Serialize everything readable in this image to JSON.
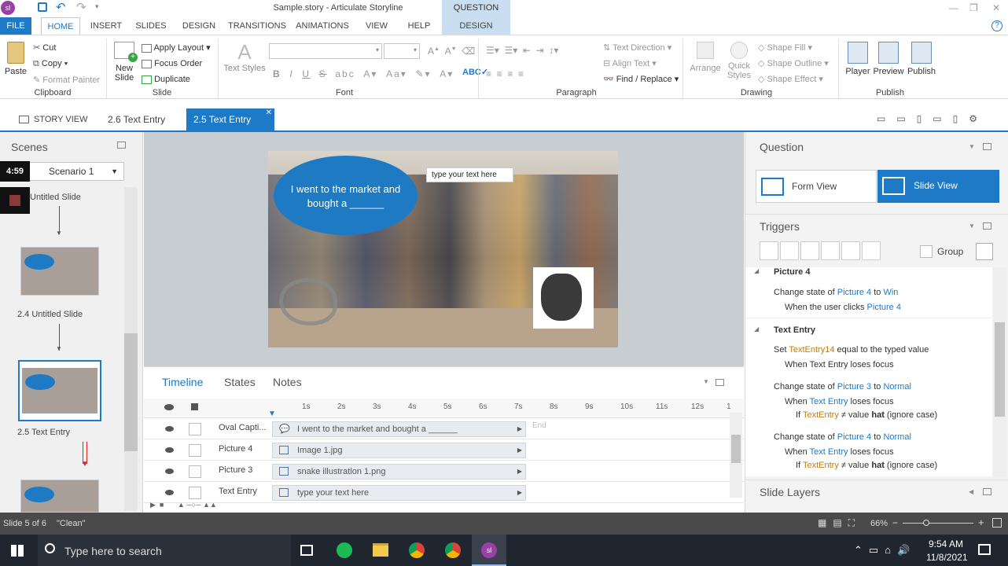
{
  "window": {
    "title": "Sample.story - Articulate Storyline",
    "context_tab": "QUESTION TOOLS"
  },
  "ribbon_tabs": [
    "FILE",
    "HOME",
    "INSERT",
    "SLIDES",
    "DESIGN",
    "TRANSITIONS",
    "ANIMATIONS",
    "VIEW",
    "HELP",
    "DESIGN"
  ],
  "clipboard": {
    "paste": "Paste",
    "cut": "Cut",
    "copy": "Copy",
    "format_painter": "Format Painter",
    "label": "Clipboard"
  },
  "slide_grp": {
    "new_slide": "New Slide",
    "apply_layout": "Apply Layout",
    "focus_order": "Focus Order",
    "duplicate": "Duplicate",
    "label": "Slide"
  },
  "font_grp": {
    "text_styles": "Text Styles",
    "label": "Font"
  },
  "paragraph_grp": {
    "text_direction": "Text Direction",
    "align_text": "Align Text",
    "find_replace": "Find / Replace",
    "label": "Paragraph"
  },
  "drawing_grp": {
    "arrange": "Arrange",
    "quick_styles": "Quick Styles",
    "shape_fill": "Shape Fill",
    "shape_outline": "Shape Outline",
    "shape_effect": "Shape Effect",
    "label": "Drawing"
  },
  "publish_grp": {
    "player": "Player",
    "preview": "Preview",
    "publish": "Publish",
    "label": "Publish"
  },
  "view_tabs": {
    "story_view": "STORY VIEW",
    "tab1": "2.6 Text Entry",
    "tab2": "2.5 Text Entry"
  },
  "scenes": {
    "title": "Scenes",
    "timer": "4:59",
    "scenario": "Scenario 1",
    "slides": [
      {
        "label": "Untitled Slide"
      },
      {
        "label": "2.4 Untitled Slide"
      },
      {
        "label": "2.5 Text Entry"
      }
    ]
  },
  "slide": {
    "bubble_text": "I went to the market and bought a ______",
    "text_entry_placeholder": "type your text here"
  },
  "timeline": {
    "tabs": [
      "Timeline",
      "States",
      "Notes"
    ],
    "ticks": [
      "1s",
      "2s",
      "3s",
      "4s",
      "5s",
      "6s",
      "7s",
      "8s",
      "9s",
      "10s",
      "11s",
      "12s",
      "1"
    ],
    "end": "End",
    "rows": [
      {
        "name": "Oval Capti...",
        "bar": "I went to the market and bought a ______"
      },
      {
        "name": "Picture 4",
        "bar": "Image 1.jpg"
      },
      {
        "name": "Picture 3",
        "bar": "snake illustration 1.png"
      },
      {
        "name": "Text Entry",
        "bar": "type your text here"
      }
    ]
  },
  "question": {
    "title": "Question",
    "form_view": "Form View",
    "slide_view": "Slide View"
  },
  "triggers": {
    "title": "Triggers",
    "group": "Group",
    "g1": "Picture 4",
    "t1a": "Change state of ",
    "t1b": "Picture 4",
    "t1c": " to ",
    "t1d": "Win",
    "t1e": "When the user clicks ",
    "t1f": "Picture 4",
    "g2": "Text Entry",
    "t2a": "Set ",
    "t2b": "TextEntry14",
    "t2c": " equal to the typed value",
    "t2d": "When Text Entry loses focus",
    "t3a": "Change state of ",
    "t3b": "Picture 3",
    "t3c": " to ",
    "t3d": "Normal",
    "t3e": "When ",
    "t3f": "Text Entry",
    "t3g": " loses focus",
    "t3h": "If ",
    "t3i": "TextEntry",
    "t3j": " ≠ value ",
    "t3k": "hat",
    "t3l": " (ignore case)",
    "t4a": "Change state of ",
    "t4b": "Picture 4",
    "t4c": " to ",
    "t4d": "Normal",
    "t4e": "When ",
    "t4f": "Text Entry",
    "t4g": " loses focus",
    "t4h": "If ",
    "t4i": "TextEntry",
    "t4j": " ≠ value ",
    "t4k": "hat",
    "t4l": " (ignore case)"
  },
  "slide_layers": "Slide Layers",
  "status": {
    "slide": "Slide 5 of 6",
    "theme": "\"Clean\"",
    "zoom": "66%"
  },
  "taskbar": {
    "search": "Type here to search",
    "time": "9:54 AM",
    "date": "11/8/2021"
  },
  "colors": {
    "accent": "#1e79c6",
    "context": "#c9dff1"
  }
}
